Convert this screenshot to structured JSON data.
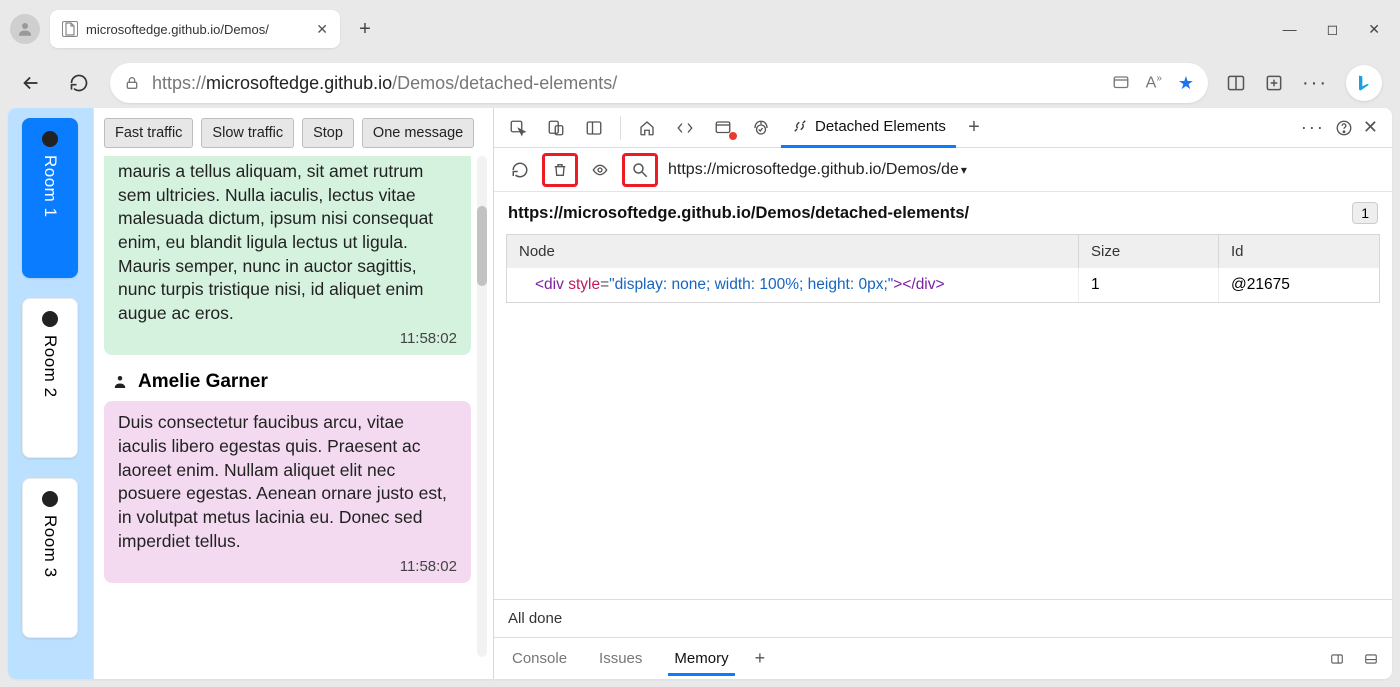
{
  "browser": {
    "tab_title": "microsoftedge.github.io/Demos/",
    "url_prefix": "https://",
    "url_host": "microsoftedge.github.io",
    "url_path": "/Demos/detached-elements/"
  },
  "page": {
    "toolbar": [
      "Fast traffic",
      "Slow traffic",
      "Stop",
      "One message"
    ],
    "rooms": [
      {
        "label": "Room 1",
        "active": true
      },
      {
        "label": "Room 2",
        "active": false
      },
      {
        "label": "Room 3",
        "active": false
      }
    ],
    "message1": {
      "text": "mauris a tellus aliquam, sit amet rutrum sem ultricies. Nulla iaculis, lectus vitae malesuada dictum, ipsum nisi consequat enim, eu blandit ligula lectus ut ligula. Mauris semper, nunc in auctor sagittis, nunc turpis tristique nisi, id aliquet enim augue ac eros.",
      "timestamp": "11:58:02"
    },
    "author2": "Amelie Garner",
    "message2": {
      "text": "Duis consectetur faucibus arcu, vitae iaculis libero egestas quis. Praesent ac laoreet enim. Nullam aliquet elit nec posuere egestas. Aenean ornare justo est, in volutpat metus lacinia eu. Donec sed imperdiet tellus.",
      "timestamp": "11:58:02"
    }
  },
  "devtools": {
    "active_tab": "Detached Elements",
    "iframe_selector": "https://microsoftedge.github.io/Demos/de",
    "page_path": "https://microsoftedge.github.io/Demos/detached-elements/",
    "count": "1",
    "columns": {
      "node": "Node",
      "size": "Size",
      "id": "Id"
    },
    "row": {
      "node_tag_open": "<div ",
      "node_attr": "style",
      "node_eq": "=",
      "node_str": "\"display: none; width: 100%; height: 0px;\"",
      "node_tag_close": "></div>",
      "size": "1",
      "id": "@21675"
    },
    "status": "All done",
    "drawer": {
      "console": "Console",
      "issues": "Issues",
      "memory": "Memory"
    }
  }
}
